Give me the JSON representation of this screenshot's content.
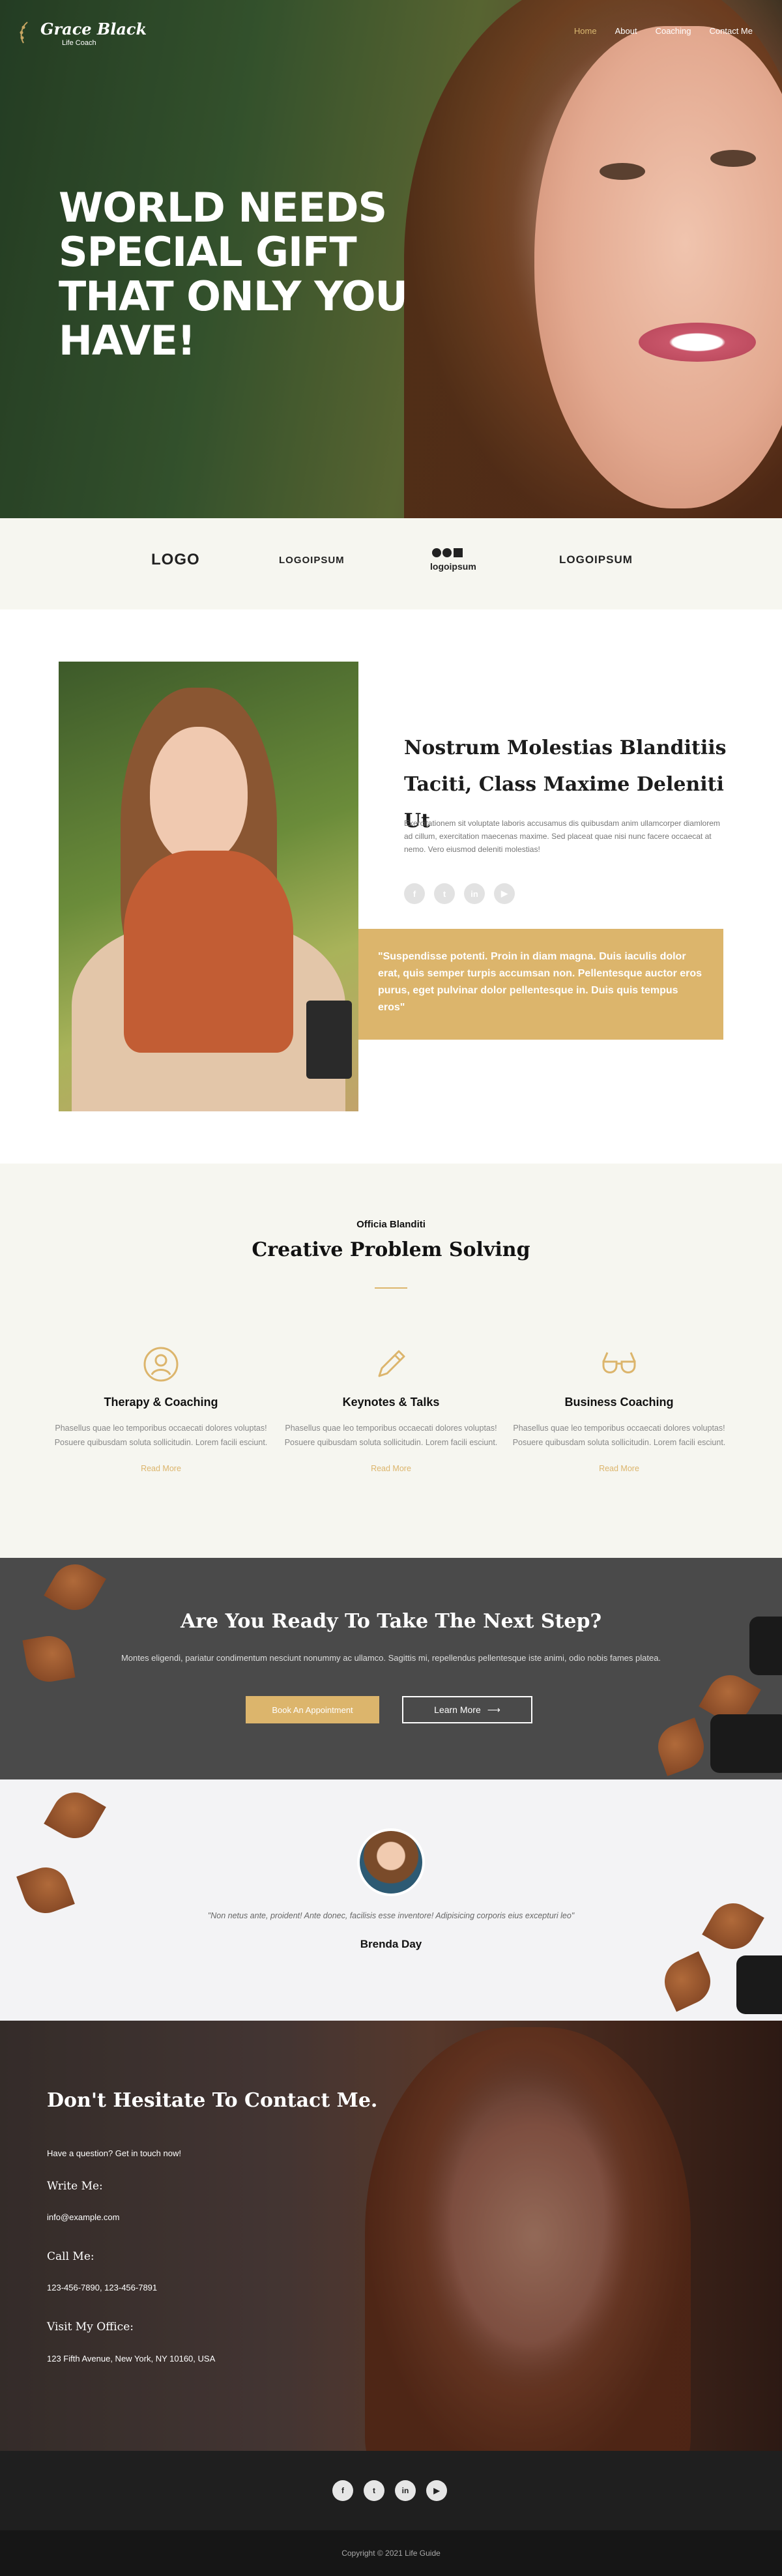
{
  "brand": {
    "name": "Grace Black",
    "tagline": "Life Coach"
  },
  "nav": {
    "items": [
      "Home",
      "About",
      "Coaching",
      "Contact Me"
    ],
    "active": "Home"
  },
  "hero": {
    "title": "WORLD NEEDS SPECIAL GIFT THAT ONLY YOU HAVE!"
  },
  "logos": [
    "LOGO",
    "LOGOIPSUM",
    "logoipsum",
    "LOGOIPSUM"
  ],
  "about": {
    "title": "Nostrum Molestias Blanditiis Taciti, Class Maxime Deleniti Ut",
    "text": "Exercitationem sit voluptate laboris accusamus dis quibusdam anim ullamcorper diamlorem ad cillum, exercitation maecenas maxime. Sed placeat quae nisi nunc facere occaecat at nemo. Vero eiusmod deleniti molestias!",
    "socials": [
      "facebook-icon",
      "twitter-icon",
      "linkedin-icon",
      "youtube-icon"
    ],
    "quote": "\"Suspendisse potenti. Proin in diam magna. Duis iaculis dolor erat, quis semper turpis accumsan non. Pellentesque auctor eros purus, eget pulvinar dolor pellentesque in. Duis quis tempus eros\""
  },
  "services": {
    "kicker": "Officia Blanditi",
    "title": "Creative Problem Solving",
    "items": [
      {
        "title": "Therapy & Coaching",
        "text": "Phasellus quae leo temporibus occaecati dolores voluptas! Posuere quibusdam soluta sollicitudin. Lorem facili esciunt.",
        "link": "Read More",
        "icon": "user-icon"
      },
      {
        "title": "Keynotes & Talks",
        "text": "Phasellus quae leo temporibus occaecati dolores voluptas! Posuere quibusdam soluta sollicitudin. Lorem facili esciunt.",
        "link": "Read More",
        "icon": "pencil-icon"
      },
      {
        "title": "Business Coaching",
        "text": "Phasellus quae leo temporibus occaecati dolores voluptas! Posuere quibusdam soluta sollicitudin. Lorem facili esciunt.",
        "link": "Read More",
        "icon": "glasses-icon"
      }
    ]
  },
  "cta": {
    "title": "Are You Ready To Take The Next Step?",
    "text": "Montes eligendi, pariatur condimentum nesciunt nonummy ac ullamco. Sagittis mi, repellendus pellentesque iste animi, odio nobis fames platea.",
    "primary": "Book An Appointment",
    "secondary": "Learn More"
  },
  "testimonial": {
    "quote": "\"Non netus ante, proident! Ante donec, facilisis esse inventore! Adipisicing corporis eius excepturi leo\"",
    "name": "Brenda Day"
  },
  "contact": {
    "title": "Don't Hesitate To Contact Me.",
    "sub": "Have a question? Get in touch now!",
    "write_label": "Write Me:",
    "email": "info@example.com",
    "call_label": "Call Me:",
    "phone": "123-456-7890, 123-456-7891",
    "office_label": "Visit My Office:",
    "address": "123 Fifth Avenue, New York, NY 10160, USA"
  },
  "footer": {
    "icons": [
      "facebook-icon",
      "twitter-icon",
      "linkedin-icon",
      "youtube-icon"
    ],
    "copyright": "Copyright © 2021 Life Guide"
  },
  "colors": {
    "accent": "#dcb56c",
    "dark": "#4a4a4a",
    "footer": "#1f1f1f",
    "light_bg": "#f6f6f0"
  }
}
